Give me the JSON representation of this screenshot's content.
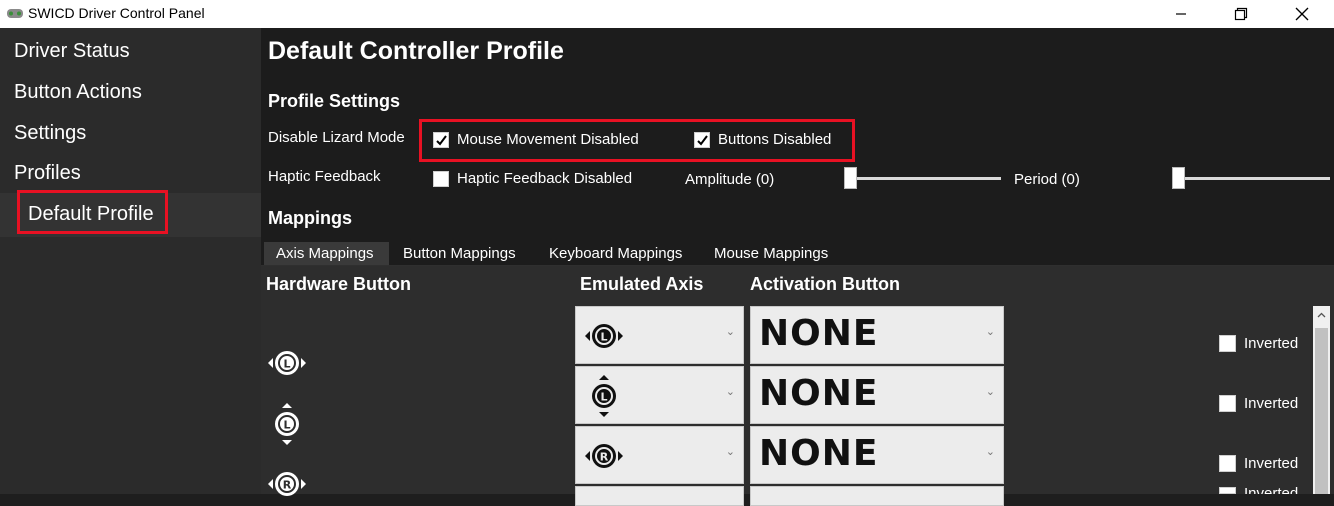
{
  "window": {
    "title": "SWICD Driver Control Panel",
    "minimize_icon": "minimize-icon",
    "maximize_icon": "restore-icon",
    "close_icon": "close-icon"
  },
  "sidebar": {
    "items": [
      {
        "label": "Driver Status"
      },
      {
        "label": "Button Actions"
      },
      {
        "label": "Settings"
      },
      {
        "label": "Profiles"
      },
      {
        "label": "Default Profile"
      }
    ]
  },
  "main": {
    "title": "Default Controller Profile",
    "profile_settings": {
      "heading": "Profile Settings",
      "lizard_label": "Disable Lizard Mode",
      "mouse_movement_label": "Mouse Movement Disabled",
      "mouse_movement_checked": true,
      "buttons_label": "Buttons Disabled",
      "buttons_checked": true,
      "haptic_label": "Haptic Feedback",
      "haptic_disabled_label": "Haptic Feedback Disabled",
      "haptic_disabled_checked": false,
      "amplitude_label": "Amplitude (0)",
      "period_label": "Period (0)"
    },
    "mappings": {
      "heading": "Mappings",
      "tabs": [
        {
          "label": "Axis Mappings",
          "active": true
        },
        {
          "label": "Button Mappings",
          "active": false
        },
        {
          "label": "Keyboard Mappings",
          "active": false
        },
        {
          "label": "Mouse Mappings",
          "active": false
        }
      ],
      "columns": {
        "hardware": "Hardware Button",
        "emulated": "Emulated Axis",
        "activation": "Activation Button"
      },
      "rows": [
        {
          "hardware_icon": "left-stick-horizontal-icon",
          "emulated_icon": "left-stick-horizontal-icon",
          "activation": "NONE",
          "inverted_label": "Inverted",
          "inverted": false
        },
        {
          "hardware_icon": "left-stick-vertical-icon",
          "emulated_icon": "left-stick-vertical-icon",
          "activation": "NONE",
          "inverted_label": "Inverted",
          "inverted": false
        },
        {
          "hardware_icon": "right-stick-horizontal-icon",
          "emulated_icon": "right-stick-horizontal-icon",
          "activation": "NONE",
          "inverted_label": "Inverted",
          "inverted": false
        },
        {
          "inverted_label": "Inverted"
        }
      ]
    }
  },
  "colors": {
    "highlight": "#e81123",
    "sidebar_bg": "#2b2b2b",
    "main_bg": "#1c1c1c",
    "grid_bg": "#2d2d2d"
  }
}
